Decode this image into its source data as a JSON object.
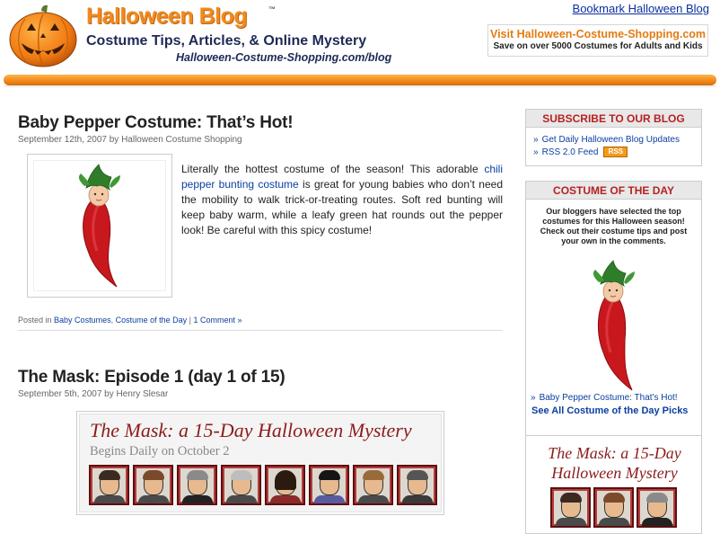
{
  "header": {
    "title": "Halloween Blog",
    "trademark": "™",
    "tagline": "Costume Tips, Articles, & Online Mystery",
    "url": "Halloween-Costume-Shopping.com/blog",
    "bookmark": "Bookmark Halloween Blog",
    "promo_line1": "Visit Halloween-Costume-Shopping.com",
    "promo_line2": "Save on over 5000 Costumes for Adults and Kids"
  },
  "posts": [
    {
      "title": "Baby Pepper Costume: That’s Hot!",
      "meta": "September 12th, 2007 by Halloween Costume Shopping",
      "body_pre": "Literally the hottest costume of the season! This adorable ",
      "body_link": "chili pepper bunting costume",
      "body_post": " is great for young babies who don’t need the mobility to walk trick-or-treating routes. Soft red bunting will keep baby warm, while a leafy green hat rounds out the pepper look! Be careful with this spicy costume!",
      "footer_prefix": "Posted in",
      "category1": "Baby Costumes",
      "category2": "Costume of the Day",
      "separator": "|",
      "comments": "1 Comment »"
    },
    {
      "title": "The Mask: Episode 1 (day 1 of 15)",
      "meta": "September 5th, 2007 by Henry Slesar",
      "banner_title": "The Mask: a 15-Day Halloween Mystery",
      "banner_sub": "Begins Daily on October 2"
    }
  ],
  "sidebar": {
    "subscribe_title": "SUBSCRIBE TO OUR BLOG",
    "subscribe_items": [
      "Get Daily Halloween Blog Updates",
      "RSS 2.0 Feed"
    ],
    "rss_badge": "RSS",
    "cotd_title": "COSTUME OF THE DAY",
    "cotd_desc": "Our bloggers have selected the top costumes for this Halloween season! Check out their costume tips and post your own in the comments.",
    "cotd_link": "Baby Pepper Costume: That's Hot!",
    "cotd_all": "See All Costume of the Day Picks",
    "mask_title_line1": "The Mask: a 15-Day",
    "mask_title_line2": "Halloween Mystery"
  },
  "colors": {
    "brand_orange": "#f08a1c",
    "nav_navy": "#1e2a55",
    "accent_red": "#b52222",
    "link_blue": "#0b3fa0"
  }
}
